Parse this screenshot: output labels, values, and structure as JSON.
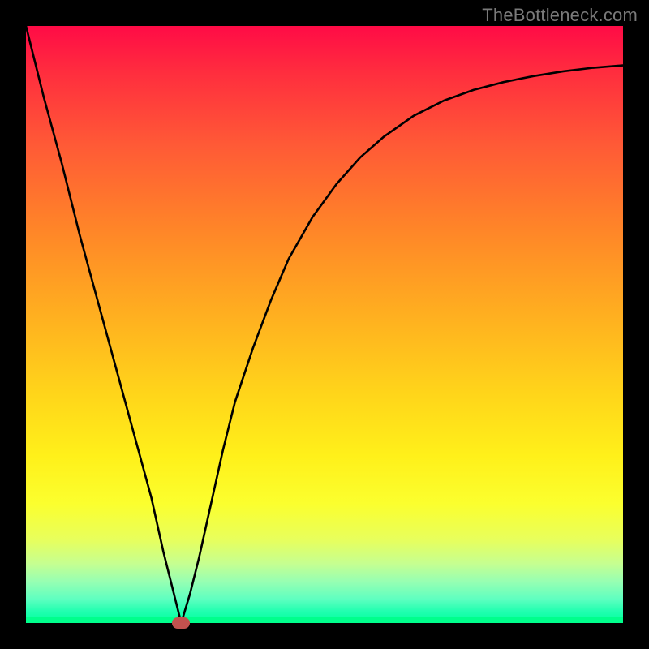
{
  "watermark": "TheBottleneck.com",
  "chart_data": {
    "type": "line",
    "title": "",
    "xlabel": "",
    "ylabel": "",
    "xlim": [
      0,
      100
    ],
    "ylim": [
      0,
      100
    ],
    "grid": false,
    "legend": false,
    "annotations": [
      {
        "name": "marker",
        "x": 26,
        "y": 0
      }
    ],
    "series": [
      {
        "name": "bottleneck-curve",
        "x": [
          0,
          3,
          6,
          9,
          12,
          15,
          18,
          21,
          23,
          24.5,
          26,
          27.5,
          29,
          31,
          33,
          35,
          38,
          41,
          44,
          48,
          52,
          56,
          60,
          65,
          70,
          75,
          80,
          85,
          90,
          95,
          100
        ],
        "y": [
          100,
          88,
          77,
          65,
          54,
          43,
          32,
          21,
          12,
          6,
          0,
          5,
          11,
          20,
          29,
          37,
          46,
          54,
          61,
          68,
          73.5,
          78,
          81.5,
          85,
          87.5,
          89.3,
          90.6,
          91.6,
          92.4,
          93,
          93.4
        ]
      }
    ],
    "background_gradient": {
      "top": "#ff0b46",
      "mid": "#ffd61a",
      "bottom": "#00ff8c"
    }
  }
}
